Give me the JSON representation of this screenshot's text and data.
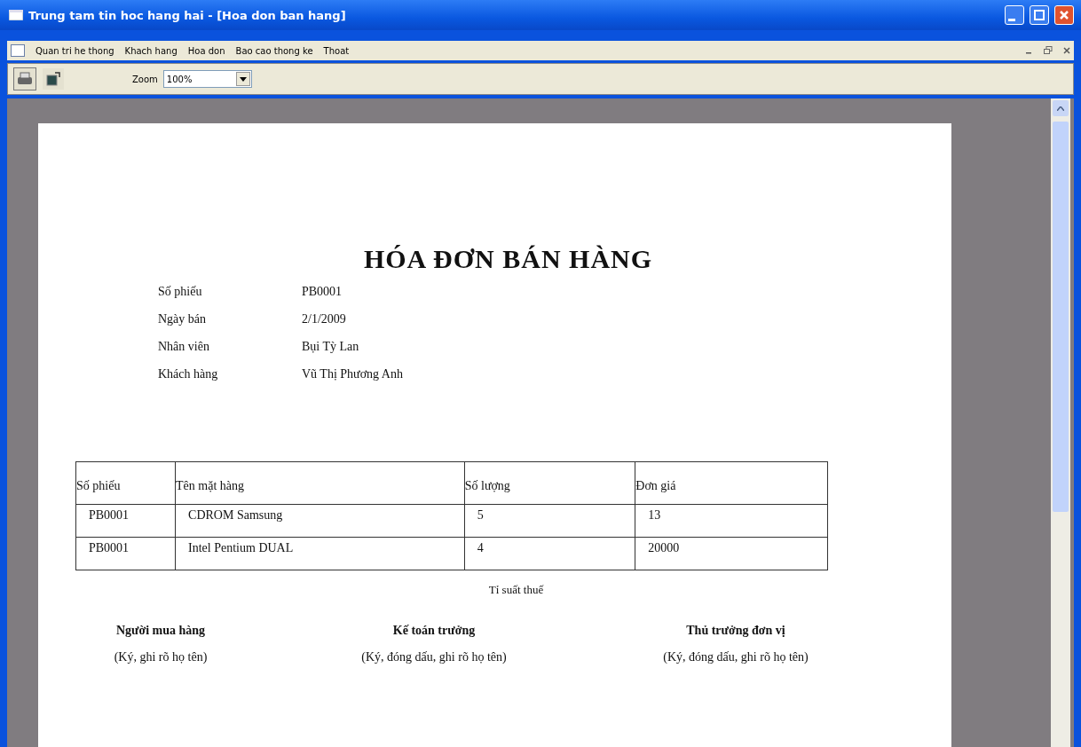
{
  "window": {
    "title": "Trung tam tin hoc hang hai - [Hoa don ban hang]"
  },
  "menu": [
    "Quan tri he thong",
    "Khach hang",
    "Hoa don",
    "Bao cao thong ke",
    "Thoat"
  ],
  "toolbar": {
    "zoom_label": "Zoom",
    "zoom_value": "100%"
  },
  "report": {
    "title": "HÓA ĐƠN BÁN HÀNG",
    "fields": [
      {
        "label": "Số phiếu",
        "value": "PB0001"
      },
      {
        "label": "Ngày bán",
        "value": "2/1/2009"
      },
      {
        "label": "Nhân viên",
        "value": "Bụi Tỳ Lan"
      },
      {
        "label": "Khách hàng",
        "value": "Vũ Thị Phương Anh"
      }
    ],
    "table": {
      "columns": [
        "Số phiếu",
        "Tên mặt hàng",
        "Số lượng",
        "Đơn giá"
      ],
      "rows": [
        [
          "PB0001",
          "CDROM Samsung",
          "5",
          "13"
        ],
        [
          "PB0001",
          "Intel Pentium DUAL",
          "4",
          "20000"
        ]
      ]
    },
    "tax_label": "Tỉ suất thuế",
    "signatures": [
      {
        "role": "Người mua hàng",
        "note": "(Ký, ghi rõ họ tên)"
      },
      {
        "role": "Kế toán trưởng",
        "note": "(Ký, đóng dấu, ghi rõ họ tên)"
      },
      {
        "role": "Thủ trưởng đơn vị",
        "note": "(Ký, đóng dấu, ghi rõ họ tên)"
      }
    ]
  }
}
